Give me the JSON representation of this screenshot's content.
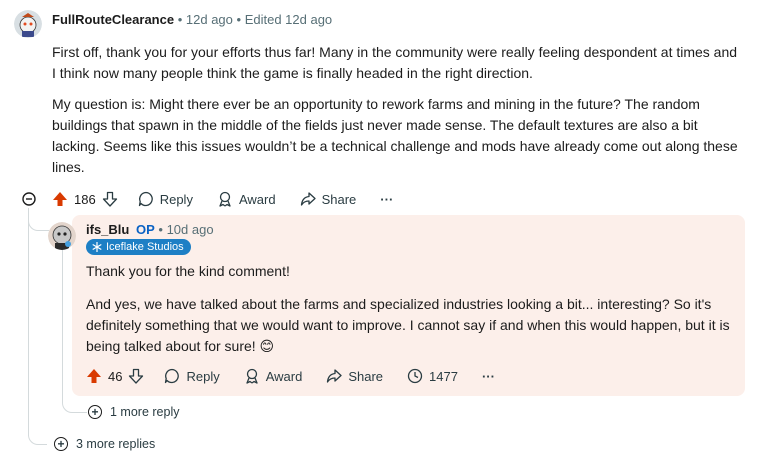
{
  "comment": {
    "author": "FullRouteClearance",
    "time": "12d ago",
    "edited": "Edited 12d ago",
    "paragraphs": [
      "First off, thank you for your efforts thus far! Many in the community were really feeling despondent at times and I think now many people think the game is finally headed in the right direction.",
      "My question is: Might there ever be an opportunity to rework farms and mining in the future? The random buildings that spawn in the middle of the fields just never made sense. The default textures are also a bit lacking. Seems like this issues wouldn’t be a technical challenge and mods have already come out along these lines."
    ],
    "votes": "186",
    "reply_label": "Reply",
    "award_label": "Award",
    "share_label": "Share",
    "more_label": "···"
  },
  "reply": {
    "author": "ifs_Blu",
    "op_badge": "OP",
    "time": "10d ago",
    "flair": "Iceflake Studios",
    "paragraphs": [
      "Thank you for the kind comment!",
      "And yes, we have talked about the farms and specialized industries looking a bit... interesting? So it's definitely something that we would want to improve. I cannot say if and when this would happen, but it is being talked about for sure! 😊"
    ],
    "votes": "46",
    "reply_label": "Reply",
    "award_label": "Award",
    "share_label": "Share",
    "views": "1477",
    "more_label": "···"
  },
  "more_reply": "1 more reply",
  "more_replies": "3 more replies",
  "colors": {
    "upvote": "#d93a00",
    "reply_bg": "#fcefea",
    "flair": "#1d7fc5",
    "op": "#0a62c4"
  },
  "icons": [
    "upvote-icon",
    "downvote-icon",
    "reply-icon",
    "award-icon",
    "share-icon",
    "views-icon",
    "collapse-icon",
    "expand-icon"
  ]
}
